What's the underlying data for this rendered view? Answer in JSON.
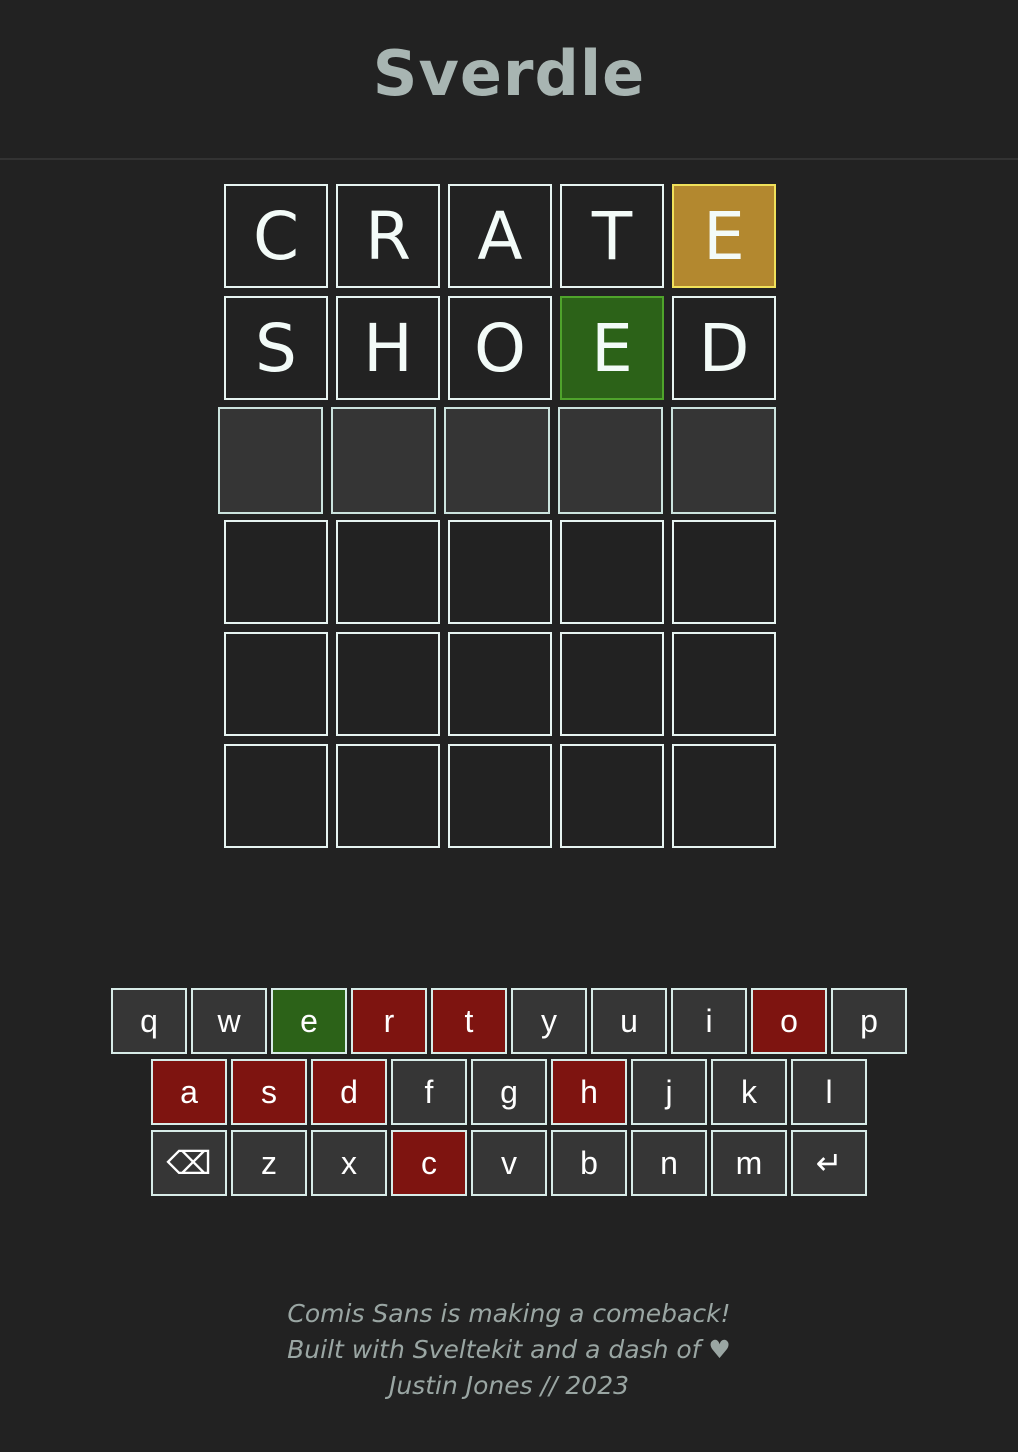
{
  "app": {
    "title": "Sverdle"
  },
  "board": {
    "rows": [
      {
        "letters": [
          "C",
          "R",
          "A",
          "T",
          "E"
        ],
        "states": [
          "empty",
          "empty",
          "empty",
          "empty",
          "present"
        ]
      },
      {
        "letters": [
          "S",
          "H",
          "O",
          "E",
          "D"
        ],
        "states": [
          "empty",
          "empty",
          "empty",
          "correct",
          "empty"
        ]
      },
      {
        "letters": [
          "",
          "",
          "",
          "",
          ""
        ],
        "states": [
          "current",
          "current",
          "current",
          "current",
          "current"
        ]
      },
      {
        "letters": [
          "",
          "",
          "",
          "",
          ""
        ],
        "states": [
          "empty",
          "empty",
          "empty",
          "empty",
          "empty"
        ]
      },
      {
        "letters": [
          "",
          "",
          "",
          "",
          ""
        ],
        "states": [
          "empty",
          "empty",
          "empty",
          "empty",
          "empty"
        ]
      },
      {
        "letters": [
          "",
          "",
          "",
          "",
          ""
        ],
        "states": [
          "empty",
          "empty",
          "empty",
          "empty",
          "empty"
        ]
      }
    ]
  },
  "keyboard": {
    "rows": [
      [
        {
          "label": "q",
          "state": "unused"
        },
        {
          "label": "w",
          "state": "unused"
        },
        {
          "label": "e",
          "state": "correct"
        },
        {
          "label": "r",
          "state": "absent"
        },
        {
          "label": "t",
          "state": "absent"
        },
        {
          "label": "y",
          "state": "unused"
        },
        {
          "label": "u",
          "state": "unused"
        },
        {
          "label": "i",
          "state": "unused"
        },
        {
          "label": "o",
          "state": "absent"
        },
        {
          "label": "p",
          "state": "unused"
        }
      ],
      [
        {
          "label": "a",
          "state": "absent"
        },
        {
          "label": "s",
          "state": "absent"
        },
        {
          "label": "d",
          "state": "absent"
        },
        {
          "label": "f",
          "state": "unused"
        },
        {
          "label": "g",
          "state": "unused"
        },
        {
          "label": "h",
          "state": "absent"
        },
        {
          "label": "j",
          "state": "unused"
        },
        {
          "label": "k",
          "state": "unused"
        },
        {
          "label": "l",
          "state": "unused"
        }
      ],
      [
        {
          "label": "⌫",
          "state": "unused",
          "icon": "backspace-icon"
        },
        {
          "label": "z",
          "state": "unused"
        },
        {
          "label": "x",
          "state": "unused"
        },
        {
          "label": "c",
          "state": "absent"
        },
        {
          "label": "v",
          "state": "unused"
        },
        {
          "label": "b",
          "state": "unused"
        },
        {
          "label": "n",
          "state": "unused"
        },
        {
          "label": "m",
          "state": "unused"
        },
        {
          "label": "↵",
          "state": "unused",
          "icon": "enter-icon"
        }
      ]
    ]
  },
  "footer": {
    "line1": "Comis Sans is making a comeback!",
    "line2": "Built with Sveltekit and a dash of ♥",
    "line3": "Justin Jones // 2023"
  }
}
